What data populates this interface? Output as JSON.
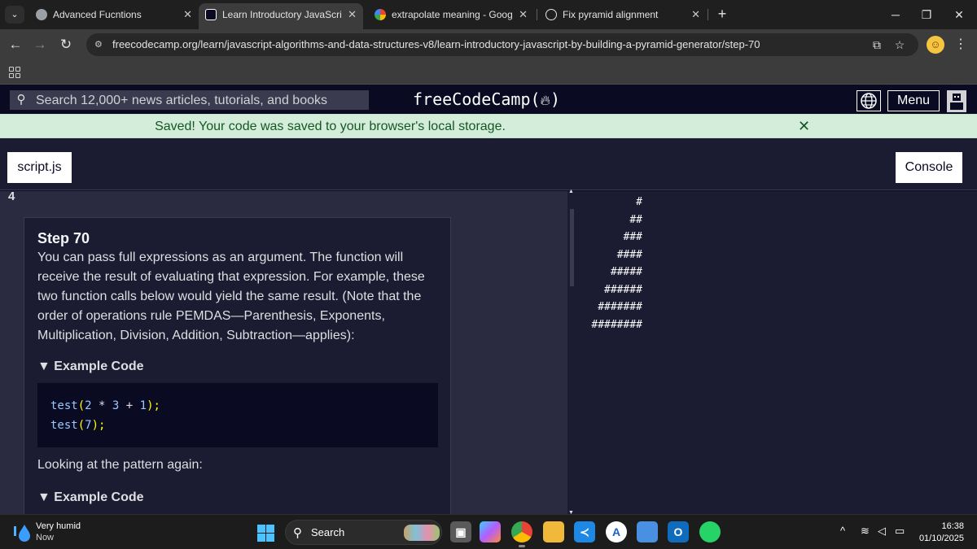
{
  "browser": {
    "tabs": [
      {
        "title": "Advanced Fucntions",
        "favicon": "globe-icon",
        "active": false
      },
      {
        "title": "Learn Introductory JavaScript by Building a Pyramid Generator",
        "favicon": "freecodecamp-icon",
        "active": true
      },
      {
        "title": "extrapolate meaning - Google Search",
        "favicon": "google-icon",
        "active": false
      },
      {
        "title": "Fix pyramid alignment",
        "favicon": "chatgpt-icon",
        "active": false
      }
    ],
    "url": "freecodecamp.org/learn/javascript-algorithms-and-data-structures-v8/learn-introductory-javascript-by-building-a-pyramid-generator/step-70"
  },
  "nav": {
    "search_placeholder": "Search 12,000+ news articles, tutorials, and books",
    "logo_text": "freeCodeCamp",
    "menu_label": "Menu"
  },
  "flash": {
    "message": "Saved! Your code was saved to your browser's local storage.",
    "close_glyph": "✕"
  },
  "editor": {
    "file_tab": "script.js",
    "console_button": "Console",
    "line_number": "4"
  },
  "instructions": {
    "title": "Step 70",
    "text": "You can pass full expressions as an argument. The function will receive the result of evaluating that expression. For example, these two function calls below would yield the same result. (Note that the order of operations rule PEMDAS—Parenthesis, Exponents, Multiplication, Division, Addition, Subtraction—applies):",
    "example_summary_1": "Example Code",
    "code_line_1": {
      "fn": "test",
      "open": "(",
      "a": "2",
      "op1": " * ",
      "b": "3",
      "op2": " + ",
      "c": "1",
      "close": ");"
    },
    "code_line_2": {
      "fn": "test",
      "open": "(",
      "a": "7",
      "close": ");"
    },
    "after_text": "Looking at the pattern again:",
    "example_summary_2": "Example Code"
  },
  "console_output": [
    "#",
    "##",
    "###",
    "####",
    "#####",
    "######",
    "#######",
    "########"
  ],
  "taskbar": {
    "weather_title": "Very humid",
    "weather_sub": "Now",
    "search_label": "Search",
    "time": "16:38",
    "date": "01/10/2025"
  },
  "colors": {
    "fcc_bg": "#0a0a23",
    "flash_bg": "#d4edda",
    "flash_text": "#155724",
    "code_function": "#99c9ff",
    "code_paren": "#ffff00"
  }
}
